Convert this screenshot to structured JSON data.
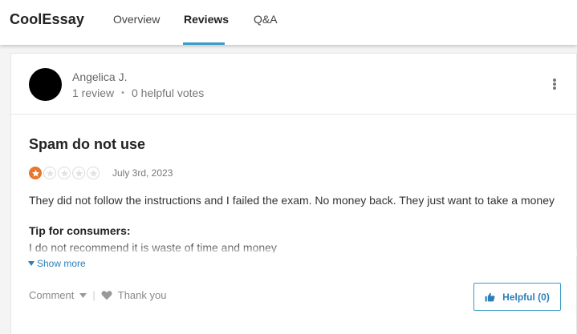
{
  "header": {
    "brand": "CoolEssay",
    "tabs": [
      {
        "label": "Overview",
        "active": false
      },
      {
        "label": "Reviews",
        "active": true
      },
      {
        "label": "Q&A",
        "active": false
      }
    ],
    "accent_color": "#3a9dc7"
  },
  "reviewer": {
    "name": "Angelica J.",
    "review_count": "1 review",
    "helpful_votes": "0 helpful votes",
    "separator": "•"
  },
  "review": {
    "title": "Spam do not use",
    "rating": 1,
    "rating_max": 5,
    "rating_color": "#e8762d",
    "date": "July 3rd, 2023",
    "body": "They did not follow the instructions and I failed the exam. No money back. They just want to take a money",
    "tip_heading": "Tip for consumers:",
    "tip_text": "I do not recommend it is waste of time and money",
    "show_more": "Show more"
  },
  "actions": {
    "comment": "Comment",
    "separator": "|",
    "thank_you": "Thank you",
    "helpful": "Helpful (0)"
  },
  "icons": {
    "menu": "kebab-menu-icon",
    "star": "star-icon",
    "show_more": "caret-down-icon",
    "comment_dropdown": "chevron-down-icon",
    "thank": "heart-icon",
    "helpful": "thumbs-up-icon"
  }
}
